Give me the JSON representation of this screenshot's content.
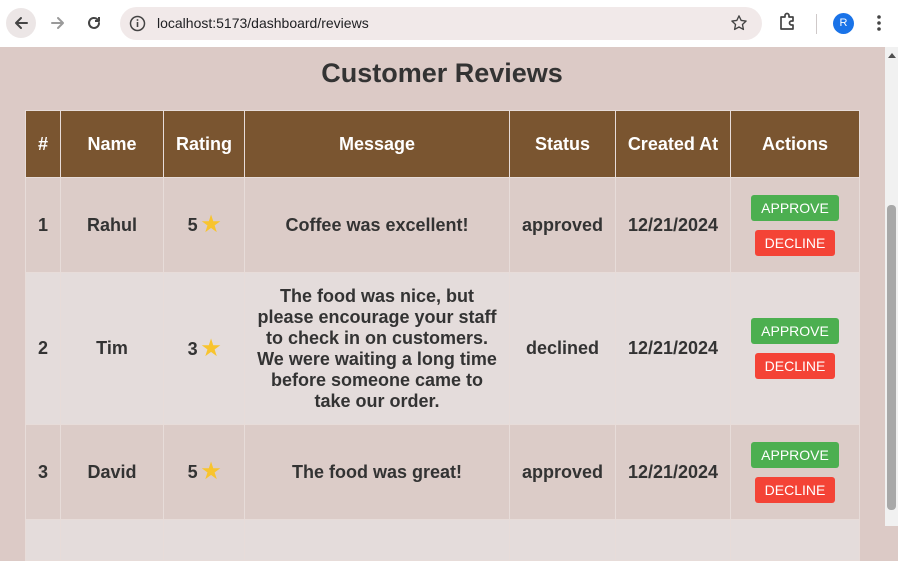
{
  "browser": {
    "url": "localhost:5173/dashboard/reviews",
    "profile_initial": "R",
    "icons": [
      "back-icon",
      "forward-icon",
      "reload-icon",
      "site-info-icon",
      "bookmark-star-icon",
      "extensions-icon",
      "menu-icon"
    ]
  },
  "page": {
    "title": "Customer Reviews"
  },
  "table": {
    "headers": [
      "#",
      "Name",
      "Rating",
      "Message",
      "Status",
      "Created At",
      "Actions"
    ],
    "rows": [
      {
        "id": "1",
        "name": "Rahul",
        "rating": "5",
        "message": "Coffee was excellent!",
        "status": "approved",
        "created_at": "12/21/2024"
      },
      {
        "id": "2",
        "name": "Tim",
        "rating": "3",
        "message": "The food was nice, but please encourage your staff to check in on customers. We were waiting a long time before someone came to take our order.",
        "status": "declined",
        "created_at": "12/21/2024"
      },
      {
        "id": "3",
        "name": "David",
        "rating": "5",
        "message": "The food was great!",
        "status": "approved",
        "created_at": "12/21/2024"
      }
    ],
    "approve_label": "APPROVE",
    "decline_label": "DECLINE",
    "rating_icon": "★"
  },
  "colors": {
    "header_bg": "#7a5530",
    "approve": "#4caf50",
    "decline": "#f44336",
    "star": "#f8c42e"
  }
}
